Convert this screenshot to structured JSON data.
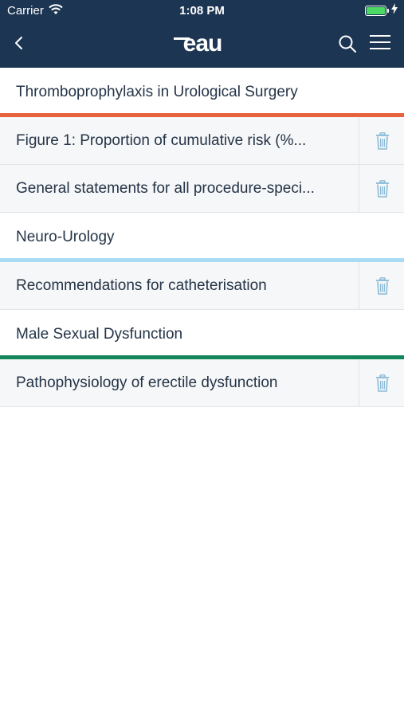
{
  "status_bar": {
    "carrier": "Carrier",
    "time": "1:08 PM"
  },
  "header": {
    "logo_text": "eau",
    "icons": [
      "back-chevron-icon",
      "search-icon",
      "hamburger-menu-icon"
    ]
  },
  "sections": [
    {
      "title": "Thromboprophylaxis in Urological Surgery",
      "accent_color": "#e8623d",
      "items": [
        "Figure 1: Proportion of cumulative risk (%...",
        "General statements for all procedure-speci..."
      ]
    },
    {
      "title": "Neuro-Urology",
      "accent_color": "#a9dcf3",
      "items": [
        "Recommendations for catheterisation"
      ]
    },
    {
      "title": "Male Sexual Dysfunction",
      "accent_color": "#12855a",
      "items": [
        "Pathophysiology of erectile dysfunction"
      ]
    }
  ],
  "colors": {
    "header_bg": "#1c3553",
    "trash_icon": "#8bbad6"
  }
}
